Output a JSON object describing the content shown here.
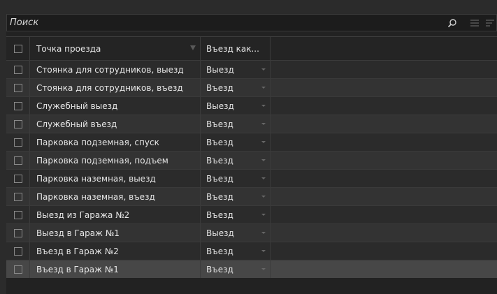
{
  "search": {
    "placeholder": "Поиск"
  },
  "columns": {
    "checkbox": "",
    "point": "Точка проезда",
    "direction": "Въезд как..."
  },
  "rows": [
    {
      "point": "Стоянка для сотрудников, выезд",
      "direction": "Выезд"
    },
    {
      "point": "Стоянка для сотрудников, въезд",
      "direction": "Въезд"
    },
    {
      "point": "Служебный выезд",
      "direction": "Выезд"
    },
    {
      "point": "Служебный въезд",
      "direction": "Въезд"
    },
    {
      "point": "Парковка подземная, спуск",
      "direction": "Въезд"
    },
    {
      "point": "Парковка подземная, подъем",
      "direction": "Въезд"
    },
    {
      "point": "Парковка наземная, выезд",
      "direction": "Въезд"
    },
    {
      "point": "Парковка наземная, въезд",
      "direction": "Въезд"
    },
    {
      "point": "Выезд из Гаража №2",
      "direction": "Въезд"
    },
    {
      "point": "Выезд в Гараж №1",
      "direction": "Выезд"
    },
    {
      "point": "Въезд в Гараж №2",
      "direction": "Въезд"
    },
    {
      "point": "Въезд в Гараж №1",
      "direction": "Въезд"
    }
  ],
  "selected_row_index": 11,
  "icons": {
    "search": "search-icon",
    "list_view": "list-view-icon",
    "filter_view": "filter-list-icon",
    "column_filter": "filter-icon",
    "dropdown": "chevron-down-icon"
  },
  "colors": {
    "background": "#2b2b2b",
    "row_alt": "#333333",
    "selected": "#474747",
    "border": "#3a3a3a"
  }
}
